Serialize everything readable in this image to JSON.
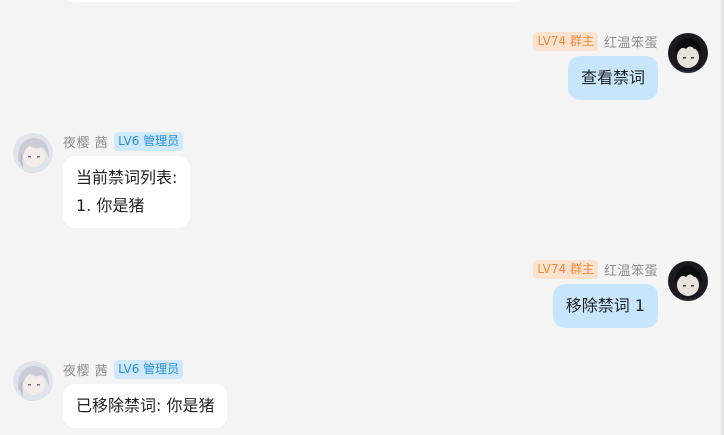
{
  "messages": [
    {
      "side": "right",
      "sender": "红温笨蛋",
      "badge": "LV74 群主",
      "lines": [
        "查看禁词"
      ]
    },
    {
      "side": "left",
      "sender": "夜樱 茜",
      "badge": "LV6 管理员",
      "lines": [
        "当前禁词列表:",
        "1. 你是猪"
      ]
    },
    {
      "side": "right",
      "sender": "红温笨蛋",
      "badge": "LV74 群主",
      "lines": [
        "移除禁词 1"
      ]
    },
    {
      "side": "left",
      "sender": "夜樱 茜",
      "badge": "LV6 管理员",
      "lines": [
        "已移除禁词: 你是猪"
      ]
    }
  ],
  "colors": {
    "background": "#f4f4f4",
    "self_bubble": "#c8e6fb",
    "other_bubble": "#ffffff",
    "owner_badge_bg": "#fde3cf",
    "owner_badge_text": "#f08a3c",
    "admin_badge_bg": "#cfe8fb",
    "admin_badge_text": "#2a8fdb"
  },
  "avatars": {
    "owner": "dark-haired-anime-boy-avatar",
    "admin": "silver-haired-anime-girl-avatar"
  }
}
